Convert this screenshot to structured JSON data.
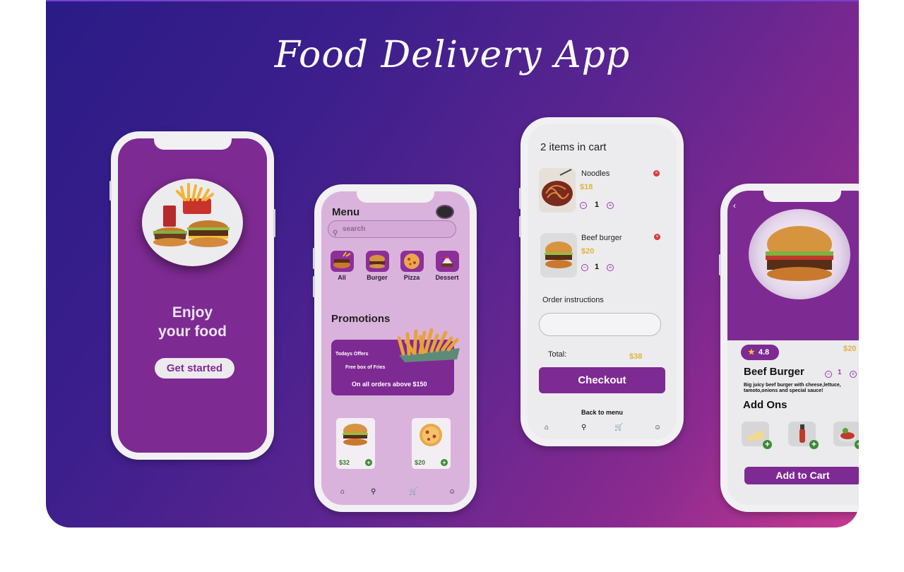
{
  "hero": {
    "title": "Food  Delivery App"
  },
  "welcome": {
    "title_line1": "Enjoy",
    "title_line2": "your food",
    "cta": "Get started"
  },
  "menu": {
    "title": "Menu",
    "search_placeholder": "search",
    "categories": [
      {
        "label": "All"
      },
      {
        "label": "Burger"
      },
      {
        "label": "Pizza"
      },
      {
        "label": "Dessert"
      }
    ],
    "promotions_title": "Promotions",
    "promo": {
      "line1": "Todays Offers",
      "line2": "Free box of Fries",
      "line3": "On all orders above $150"
    },
    "products": [
      {
        "price": "$32"
      },
      {
        "price": "$20"
      }
    ]
  },
  "cart": {
    "title": "2 items in cart",
    "items": [
      {
        "name": "Noodles",
        "price": "$18",
        "qty": "1"
      },
      {
        "name": "Beef burger",
        "price": "$20",
        "qty": "1"
      }
    ],
    "order_instructions_label": "Order instructions",
    "total_label": "Total:",
    "total_value": "$38",
    "checkout": "Checkout",
    "back_to_menu": "Back to menu"
  },
  "detail": {
    "rating": "4.8",
    "price": "$20",
    "name": "Beef Burger",
    "qty": "1",
    "description": "Big juicy beef burger with cheese,lettuce, tamoto,onions and special sauce!",
    "addons_title": "Add Ons",
    "add_to_cart": "Add to Cart"
  },
  "colors": {
    "brand": "#7e2a93",
    "accent_price": "#e0b43a",
    "add_green": "#3d8a35",
    "remove_red": "#d83a3a"
  }
}
